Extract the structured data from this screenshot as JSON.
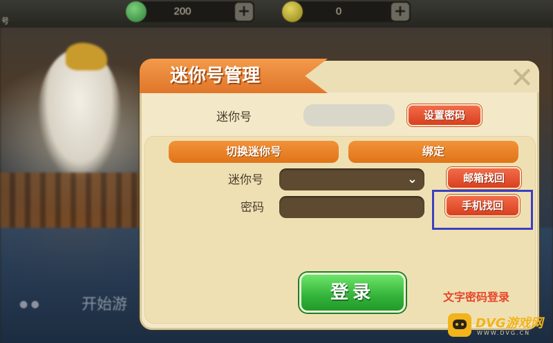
{
  "topbar": {
    "label_left": "号",
    "label_mid": "",
    "resources": [
      {
        "icon": "green-gem-icon",
        "value": "200",
        "plus": "+"
      },
      {
        "icon": "gold-coin-icon",
        "value": "0",
        "plus": "+"
      }
    ]
  },
  "hud": {
    "start_text": "开始游",
    "dots": "● ●"
  },
  "dialog": {
    "title": "迷你号管理",
    "close": "✕",
    "mini_id_label": "迷你号",
    "mini_id_value": "",
    "set_password_button": "设置密码",
    "tabs": [
      {
        "label": "切换迷你号"
      },
      {
        "label": "绑定"
      }
    ],
    "mini_id_field_label": "迷你号",
    "mini_id_dropdown_icon": "chevron-down-icon",
    "password_label": "密码",
    "email_recover_button": "邮箱找回",
    "phone_recover_button": "手机找回",
    "login_button": "登录",
    "text_password_login_link": "文字密码登录"
  },
  "watermark": {
    "brand": "DVG游戏网",
    "sub": "WWW.DVG.CN"
  },
  "colors": {
    "title_orange": "#e0762a",
    "button_red": "#d8401f",
    "tab_orange": "#e07419",
    "login_green": "#33b33a",
    "highlight_blue": "#3a3fc0",
    "link_red": "#e5462a",
    "panel_bg": "#f3e9c8"
  }
}
